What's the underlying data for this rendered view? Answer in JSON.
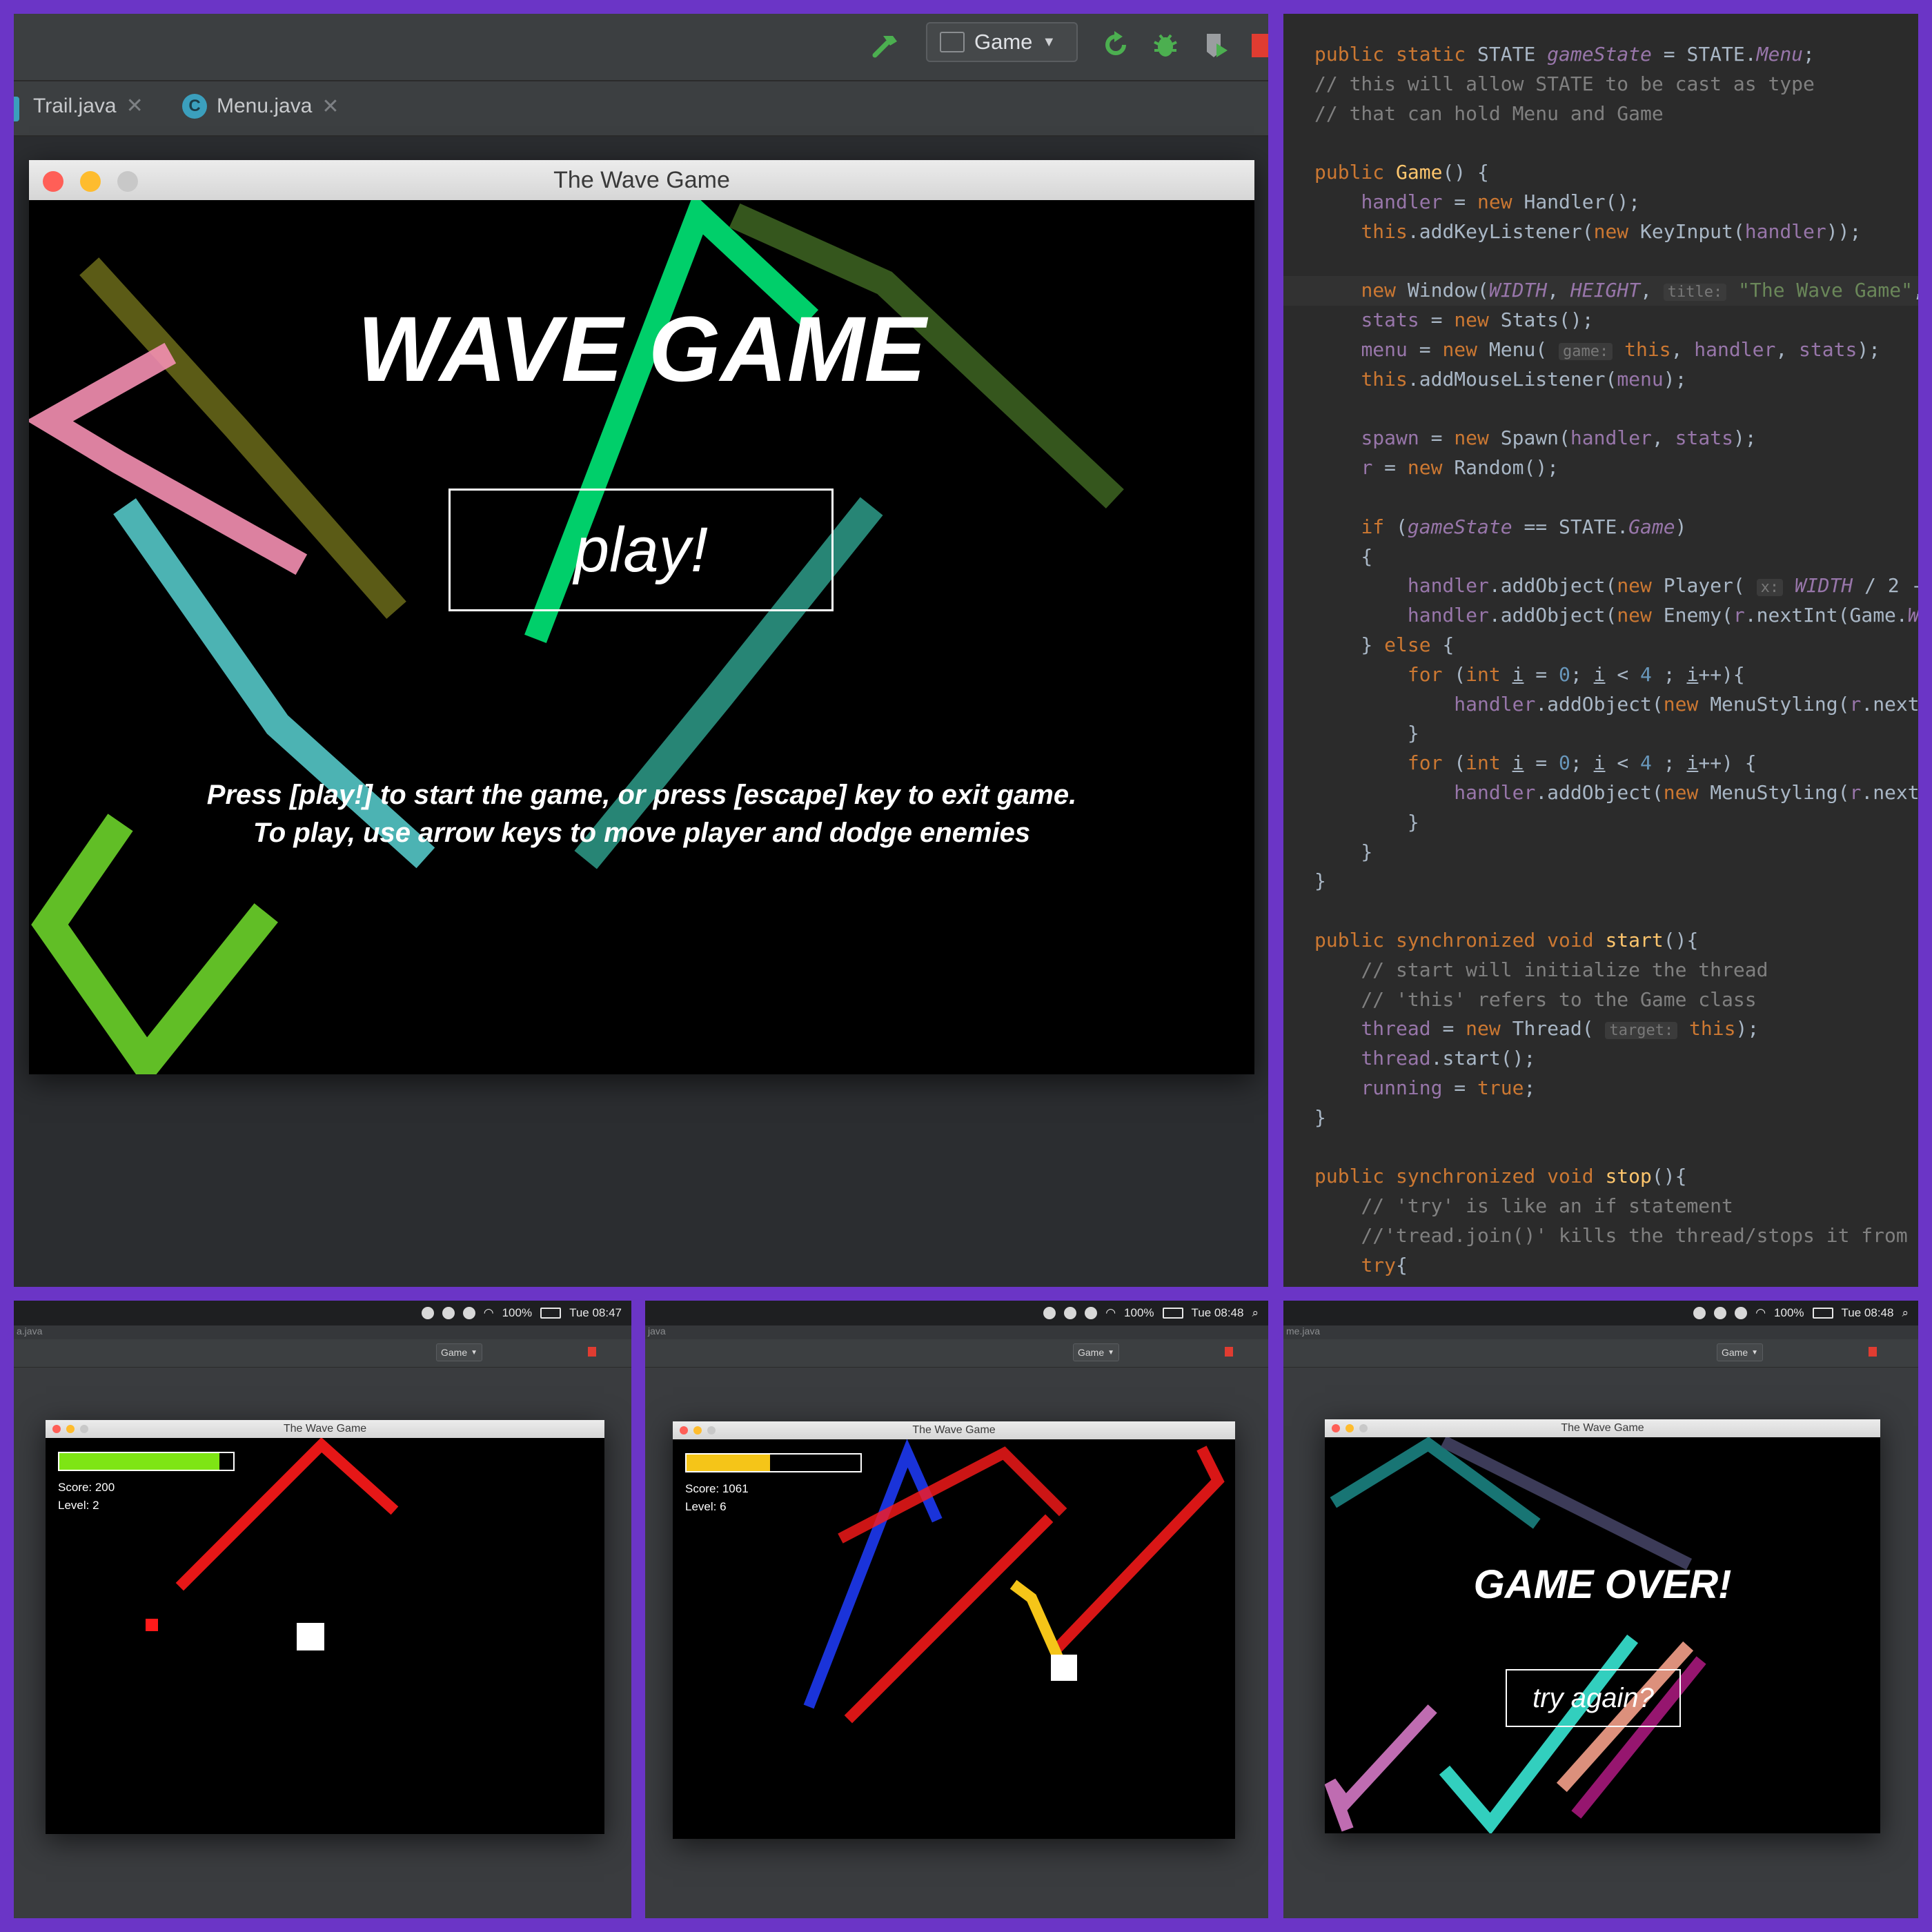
{
  "ide": {
    "run_config": "Game",
    "tabs": [
      {
        "label": "Trail.java"
      },
      {
        "label": "Menu.java",
        "icon": "class-c-icon"
      }
    ],
    "toolbar_icons": [
      "build-hammer-icon",
      "rerun-icon",
      "debug-bug-icon",
      "coverage-icon",
      "stop-icon"
    ],
    "colors": {
      "build": "#4caf50",
      "run": "#4caf50",
      "stop": "#e03c31"
    }
  },
  "game_window": {
    "title": "The Wave Game",
    "heading": "WAVE GAME",
    "play_button": "play!",
    "instructions_line1": "Press [play!] to start the game, or press [escape] key to exit game.",
    "instructions_line2": "To play, use arrow keys to move player and dodge enemies",
    "trail_colors": [
      "#00e676",
      "#8bc34a",
      "#f48fb1",
      "#6b6b1a",
      "#5fe0e0",
      "#2e9c8a",
      "#6bd32a"
    ]
  },
  "code": {
    "lines": [
      {
        "segments": [
          [
            "kw",
            "public static "
          ],
          [
            "txt",
            "STATE "
          ],
          [
            "fldi",
            "gameState"
          ],
          [
            "txt",
            " = STATE."
          ],
          [
            "fldi",
            "Menu"
          ],
          [
            "txt",
            ";"
          ]
        ]
      },
      {
        "segments": [
          [
            "cmt",
            "// this will allow STATE to be cast as type"
          ]
        ]
      },
      {
        "segments": [
          [
            "cmt",
            "// that can hold Menu and Game"
          ]
        ]
      },
      {
        "segments": []
      },
      {
        "segments": [
          [
            "kw",
            "public "
          ],
          [
            "fn",
            "Game"
          ],
          [
            "txt",
            "() {"
          ]
        ]
      },
      {
        "segments": [
          [
            "txt",
            "    "
          ],
          [
            "fld",
            "handler"
          ],
          [
            "txt",
            " = "
          ],
          [
            "kw",
            "new "
          ],
          [
            "txt",
            "Handler();"
          ]
        ]
      },
      {
        "segments": [
          [
            "txt",
            "    "
          ],
          [
            "kw",
            "this"
          ],
          [
            "txt",
            ".addKeyListener("
          ],
          [
            "kw",
            "new "
          ],
          [
            "txt",
            "KeyInput("
          ],
          [
            "fld",
            "handler"
          ],
          [
            "txt",
            "));"
          ]
        ]
      },
      {
        "segments": []
      },
      {
        "hl": true,
        "segments": [
          [
            "txt",
            "    "
          ],
          [
            "kw",
            "new "
          ],
          [
            "txt",
            "Window("
          ],
          [
            "fldi",
            "WIDTH"
          ],
          [
            "txt",
            ", "
          ],
          [
            "fldi",
            "HEIGHT"
          ],
          [
            "txt",
            ", "
          ],
          [
            "hint",
            "title:"
          ],
          [
            "str",
            " \"The Wave Game\""
          ],
          [
            "txt",
            ","
          ]
        ]
      },
      {
        "segments": [
          [
            "txt",
            "    "
          ],
          [
            "fld",
            "stats"
          ],
          [
            "txt",
            " = "
          ],
          [
            "kw",
            "new "
          ],
          [
            "txt",
            "Stats();"
          ]
        ]
      },
      {
        "segments": [
          [
            "txt",
            "    "
          ],
          [
            "fld",
            "menu"
          ],
          [
            "txt",
            " = "
          ],
          [
            "kw",
            "new "
          ],
          [
            "txt",
            "Menu( "
          ],
          [
            "hint",
            "game:"
          ],
          [
            "kw",
            " this"
          ],
          [
            "txt",
            ", "
          ],
          [
            "fld",
            "handler"
          ],
          [
            "txt",
            ", "
          ],
          [
            "fld",
            "stats"
          ],
          [
            "txt",
            ");"
          ]
        ]
      },
      {
        "segments": [
          [
            "txt",
            "    "
          ],
          [
            "kw",
            "this"
          ],
          [
            "txt",
            ".addMouseListener("
          ],
          [
            "fld",
            "menu"
          ],
          [
            "txt",
            ");"
          ]
        ]
      },
      {
        "segments": []
      },
      {
        "segments": [
          [
            "txt",
            "    "
          ],
          [
            "fld",
            "spawn"
          ],
          [
            "txt",
            " = "
          ],
          [
            "kw",
            "new "
          ],
          [
            "txt",
            "Spawn("
          ],
          [
            "fld",
            "handler"
          ],
          [
            "txt",
            ", "
          ],
          [
            "fld",
            "stats"
          ],
          [
            "txt",
            ");"
          ]
        ]
      },
      {
        "segments": [
          [
            "txt",
            "    "
          ],
          [
            "fld",
            "r"
          ],
          [
            "txt",
            " = "
          ],
          [
            "kw",
            "new "
          ],
          [
            "txt",
            "Random();"
          ]
        ]
      },
      {
        "segments": []
      },
      {
        "segments": [
          [
            "txt",
            "    "
          ],
          [
            "kw",
            "if "
          ],
          [
            "txt",
            "("
          ],
          [
            "fldi",
            "gameState"
          ],
          [
            "txt",
            " == STATE."
          ],
          [
            "fldi",
            "Game"
          ],
          [
            "txt",
            ")"
          ]
        ]
      },
      {
        "segments": [
          [
            "txt",
            "    {"
          ]
        ]
      },
      {
        "segments": [
          [
            "txt",
            "        "
          ],
          [
            "fld",
            "handler"
          ],
          [
            "txt",
            ".addObject("
          ],
          [
            "kw",
            "new "
          ],
          [
            "txt",
            "Player( "
          ],
          [
            "hint",
            "x:"
          ],
          [
            "fldi",
            " WIDTH"
          ],
          [
            "txt",
            " / 2 - "
          ]
        ]
      },
      {
        "segments": [
          [
            "txt",
            "        "
          ],
          [
            "fld",
            "handler"
          ],
          [
            "txt",
            ".addObject("
          ],
          [
            "kw",
            "new "
          ],
          [
            "txt",
            "Enemy("
          ],
          [
            "fld",
            "r"
          ],
          [
            "txt",
            ".nextInt(Game."
          ],
          [
            "fldi",
            "W"
          ]
        ]
      },
      {
        "segments": [
          [
            "txt",
            "    } "
          ],
          [
            "kw",
            "else "
          ],
          [
            "txt",
            "{"
          ]
        ]
      },
      {
        "segments": [
          [
            "txt",
            "        "
          ],
          [
            "kw",
            "for "
          ],
          [
            "txt",
            "("
          ],
          [
            "kw",
            "int "
          ],
          [
            "und",
            "i"
          ],
          [
            "txt",
            " = "
          ],
          [
            "num",
            "0"
          ],
          [
            "txt",
            "; "
          ],
          [
            "und",
            "i"
          ],
          [
            "txt",
            " < "
          ],
          [
            "num",
            "4"
          ],
          [
            "txt",
            " ; "
          ],
          [
            "und",
            "i"
          ],
          [
            "txt",
            "++){"
          ]
        ]
      },
      {
        "segments": [
          [
            "txt",
            "            "
          ],
          [
            "fld",
            "handler"
          ],
          [
            "txt",
            ".addObject("
          ],
          [
            "kw",
            "new "
          ],
          [
            "txt",
            "MenuStyling("
          ],
          [
            "fld",
            "r"
          ],
          [
            "txt",
            ".next"
          ]
        ]
      },
      {
        "segments": [
          [
            "txt",
            "        }"
          ]
        ]
      },
      {
        "segments": [
          [
            "txt",
            "        "
          ],
          [
            "kw",
            "for "
          ],
          [
            "txt",
            "("
          ],
          [
            "kw",
            "int "
          ],
          [
            "und",
            "i"
          ],
          [
            "txt",
            " = "
          ],
          [
            "num",
            "0"
          ],
          [
            "txt",
            "; "
          ],
          [
            "und",
            "i"
          ],
          [
            "txt",
            " < "
          ],
          [
            "num",
            "4"
          ],
          [
            "txt",
            " ; "
          ],
          [
            "und",
            "i"
          ],
          [
            "txt",
            "++) {"
          ]
        ]
      },
      {
        "segments": [
          [
            "txt",
            "            "
          ],
          [
            "fld",
            "handler"
          ],
          [
            "txt",
            ".addObject("
          ],
          [
            "kw",
            "new "
          ],
          [
            "txt",
            "MenuStyling("
          ],
          [
            "fld",
            "r"
          ],
          [
            "txt",
            ".next"
          ]
        ]
      },
      {
        "segments": [
          [
            "txt",
            "        }"
          ]
        ]
      },
      {
        "segments": [
          [
            "txt",
            "    }"
          ]
        ]
      },
      {
        "segments": [
          [
            "txt",
            "}"
          ]
        ]
      },
      {
        "segments": []
      },
      {
        "segments": [
          [
            "kw",
            "public synchronized void "
          ],
          [
            "fn",
            "start"
          ],
          [
            "txt",
            "(){"
          ]
        ]
      },
      {
        "segments": [
          [
            "txt",
            "    "
          ],
          [
            "cmt",
            "// start will initialize the thread"
          ]
        ]
      },
      {
        "segments": [
          [
            "txt",
            "    "
          ],
          [
            "cmt",
            "// 'this' refers to the Game class"
          ]
        ]
      },
      {
        "segments": [
          [
            "txt",
            "    "
          ],
          [
            "fld",
            "thread"
          ],
          [
            "txt",
            " = "
          ],
          [
            "kw",
            "new "
          ],
          [
            "txt",
            "Thread( "
          ],
          [
            "hint",
            "target:"
          ],
          [
            "kw",
            " this"
          ],
          [
            "txt",
            ");"
          ]
        ]
      },
      {
        "segments": [
          [
            "txt",
            "    "
          ],
          [
            "fld",
            "thread"
          ],
          [
            "txt",
            ".start();"
          ]
        ]
      },
      {
        "segments": [
          [
            "txt",
            "    "
          ],
          [
            "fld",
            "running"
          ],
          [
            "txt",
            " = "
          ],
          [
            "kw",
            "true"
          ],
          [
            "txt",
            ";"
          ]
        ]
      },
      {
        "segments": [
          [
            "txt",
            "}"
          ]
        ]
      },
      {
        "segments": []
      },
      {
        "segments": [
          [
            "kw",
            "public synchronized void "
          ],
          [
            "fn",
            "stop"
          ],
          [
            "txt",
            "(){"
          ]
        ]
      },
      {
        "segments": [
          [
            "txt",
            "    "
          ],
          [
            "cmt",
            "// 'try' is like an if statement"
          ]
        ]
      },
      {
        "segments": [
          [
            "txt",
            "    "
          ],
          [
            "cmt",
            "//'tread.join()' kills the thread/stops it from"
          ]
        ]
      },
      {
        "segments": [
          [
            "txt",
            "    "
          ],
          [
            "kw",
            "try"
          ],
          [
            "txt",
            "{"
          ]
        ]
      }
    ]
  },
  "shot1": {
    "file_tab": "a.java",
    "battery": "100%",
    "time": "Tue 08:47",
    "run_config": "Game",
    "window_title": "The Wave Game",
    "score": "Score: 200",
    "level": "Level: 2",
    "health": 0.92,
    "health_color": "#7ee514"
  },
  "shot2": {
    "file_tab": "java",
    "battery": "100%",
    "time": "Tue 08:48",
    "run_config": "Game",
    "window_title": "The Wave Game",
    "score": "Score: 1061",
    "level": "Level: 6",
    "health": 0.48,
    "health_color": "#f5c518"
  },
  "shot3": {
    "file_tab": "me.java",
    "battery": "100%",
    "time": "Tue 08:48",
    "run_config": "Game",
    "window_title": "The Wave Game",
    "heading": "GAME OVER!",
    "retry_button": "try again?"
  }
}
